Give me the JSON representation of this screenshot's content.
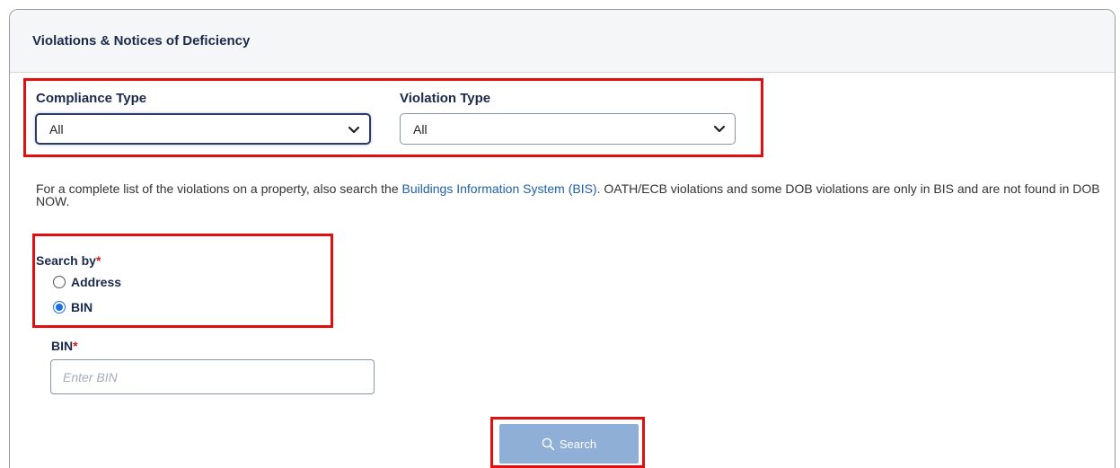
{
  "panel": {
    "title": "Violations & Notices of Deficiency"
  },
  "filters": {
    "compliance_type": {
      "label": "Compliance Type",
      "value": "All"
    },
    "violation_type": {
      "label": "Violation Type",
      "value": "All"
    }
  },
  "info": {
    "text_before": "For a complete list of the violations on a property, also search the ",
    "link": "Buildings Information System (BIS)",
    "text_after": ". OATH/ECB violations and some DOB violations are only in BIS and are not found in DOB NOW."
  },
  "search_by": {
    "label": "Search by",
    "required_mark": "*",
    "options": [
      {
        "label": "Address",
        "selected": false
      },
      {
        "label": "BIN",
        "selected": true
      }
    ]
  },
  "bin_field": {
    "label": "BIN",
    "required_mark": "*",
    "value": "",
    "placeholder": "Enter BIN"
  },
  "search_button": {
    "label": "Search",
    "icon": "search-icon"
  },
  "colors": {
    "highlight_box": "#e01010",
    "link": "#1f5fa8",
    "button": "#8fafd6",
    "required": "#d01818"
  }
}
